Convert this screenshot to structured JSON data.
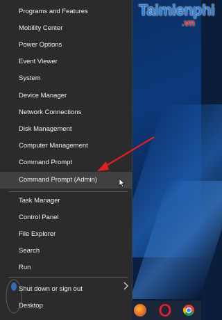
{
  "watermark": {
    "main": "Taimienphi",
    "sub": ".vn"
  },
  "menu": {
    "items": [
      {
        "label": "Programs and Features"
      },
      {
        "label": "Mobility Center"
      },
      {
        "label": "Power Options"
      },
      {
        "label": "Event Viewer"
      },
      {
        "label": "System"
      },
      {
        "label": "Device Manager"
      },
      {
        "label": "Network Connections"
      },
      {
        "label": "Disk Management"
      },
      {
        "label": "Computer Management"
      },
      {
        "label": "Command Prompt"
      },
      {
        "label": "Command Prompt (Admin)"
      },
      {
        "label": "Task Manager"
      },
      {
        "label": "Control Panel"
      },
      {
        "label": "File Explorer"
      },
      {
        "label": "Search"
      },
      {
        "label": "Run"
      },
      {
        "label": "Shut down or sign out"
      },
      {
        "label": "Desktop"
      }
    ],
    "highlighted_item": "Command Prompt (Admin)"
  },
  "taskbar": {
    "icons": [
      "firefox-icon",
      "opera-icon",
      "chrome-icon"
    ]
  },
  "colors": {
    "menu_bg": "#2b2b2b",
    "highlight_bg": "#414141",
    "arrow": "#e02020",
    "watermark_blue": "#2f7fd6",
    "watermark_red": "#e23a2a"
  }
}
